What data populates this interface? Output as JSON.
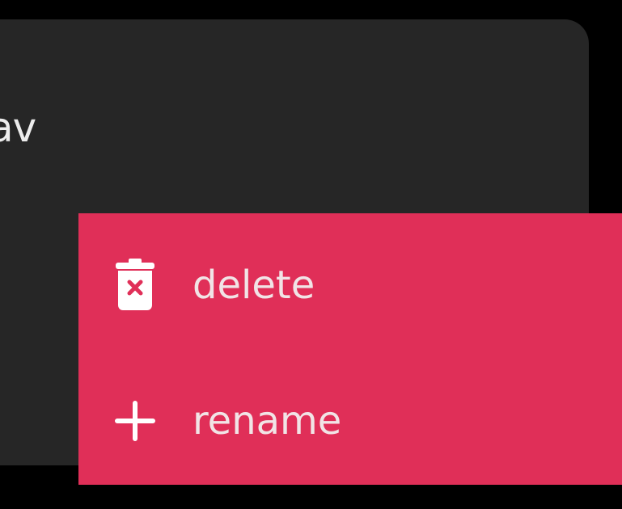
{
  "card": {
    "title_fragment": "av"
  },
  "context_menu": {
    "items": [
      {
        "label": "delete",
        "icon": "trash-x-icon"
      },
      {
        "label": "rename",
        "icon": "plus-icon"
      }
    ]
  },
  "colors": {
    "background": "#000000",
    "card": "#262626",
    "menu": "#e02f58",
    "menu_text": "#f1e4e6"
  }
}
